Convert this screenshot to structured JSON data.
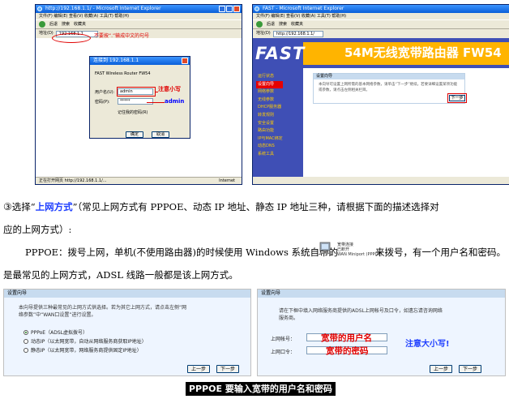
{
  "left_shot": {
    "title": "http://192.168.1.1/ - Microsoft Internet Explorer",
    "menu": "文件(F)  编辑(E)  查看(V)  收藏(A)  工具(T)  帮助(H)",
    "toolbar": [
      "后退",
      "搜索",
      "收藏夹"
    ],
    "address_label": "地址(D)",
    "address_value": "192.168.1.1",
    "hint": "不要按“.”输成中文的句号",
    "status": "正在打开网页 http://192.168.1.1/...",
    "status_right": "Internet",
    "login": {
      "title": "连接到 192.168.1.1",
      "realm": "FAST Wireless Router FW54",
      "user_label": "用户名(U):",
      "user_value": "admin",
      "pass_label": "密码(P):",
      "pass_value": "*****",
      "remember": "记住我的密码(R)",
      "ok": "确定",
      "cancel": "取消"
    },
    "note_case": "注意小写",
    "note_admin": "admin"
  },
  "right_shot": {
    "title": "FAST - Microsoft Internet Explorer",
    "menu": "文件(F)  编辑(E)  查看(V)  收藏(A)  工具(T)  帮助(H)",
    "toolbar": [
      "后退",
      "搜索",
      "收藏夹"
    ],
    "address_label": "地址(D)",
    "address_value": "http://192.168.1.1/",
    "logo": "FAST",
    "product": "54M无线宽带路由器 FW54",
    "menu_items": [
      "运行状态",
      "设置向导",
      "网络参数",
      "无线参数",
      "DHCP服务器",
      "转发规则",
      "安全设置",
      "路由功能",
      "IP与MAC绑定",
      "动态DNS",
      "系统工具"
    ],
    "wizard_header": "设置向导",
    "wizard_text": "本向导可设置上网所需的基本网络参数，请单击“下一步”继续。若要详细设置某项功能或参数，请点击左侧相关栏目。",
    "next": "下一步"
  },
  "text": {
    "step_mark": "③",
    "step_line1_a": "选择“",
    "step_line1_b": "上网方式",
    "step_line1_c": "”（常见上网方式有 PPPOE、动态 IP 地址、静态 IP 地址三种，请根据下面的描述选择对",
    "step_line2": "应的上网方式）:",
    "pppoe_line1_a": "PPPOE：拨号上网，单机(不使用路由器)的时候使用 Windows 系统自带的",
    "pppoe_line1_b": "来拨号，有一个用户名和密码。",
    "pppoe_line2": "是最常见的上网方式，ADSL 线路一般都是该上网方式。",
    "conn_label": [
      "宽带连接",
      "已断开",
      "WAN Miniport (PPPOE)"
    ]
  },
  "panel_left": {
    "header": "设置向导",
    "desc1": "本向导提供三种最常见的上网方式供选择。若为其它上网方式，请点击左侧“网",
    "desc2": "络参数”中“WAN口设置”进行设置。",
    "options": [
      "PPPoE（ADSL虚拟拨号）",
      "动态IP（以太网宽带，自动从网络服务商获取IP地址）",
      "静态IP（以太网宽带，网络服务商提供固定IP地址）"
    ],
    "prev": "上一步",
    "next": "下一步"
  },
  "panel_right": {
    "header": "设置向导",
    "desc1": "请在下框中填入网络服务商提供的ADSL上网帐号及口令，如遗忘请咨询网络",
    "desc2": "服务商。",
    "account_label": "上网帐号：",
    "password_label": "上网口令：",
    "account_overlay": "宽带的用户名",
    "password_overlay": "宽带的密码",
    "note": "注意大小写!",
    "prev": "上一步",
    "next": "下一步"
  },
  "caption": "PPPOE 要输入宽带的用户名和密码"
}
